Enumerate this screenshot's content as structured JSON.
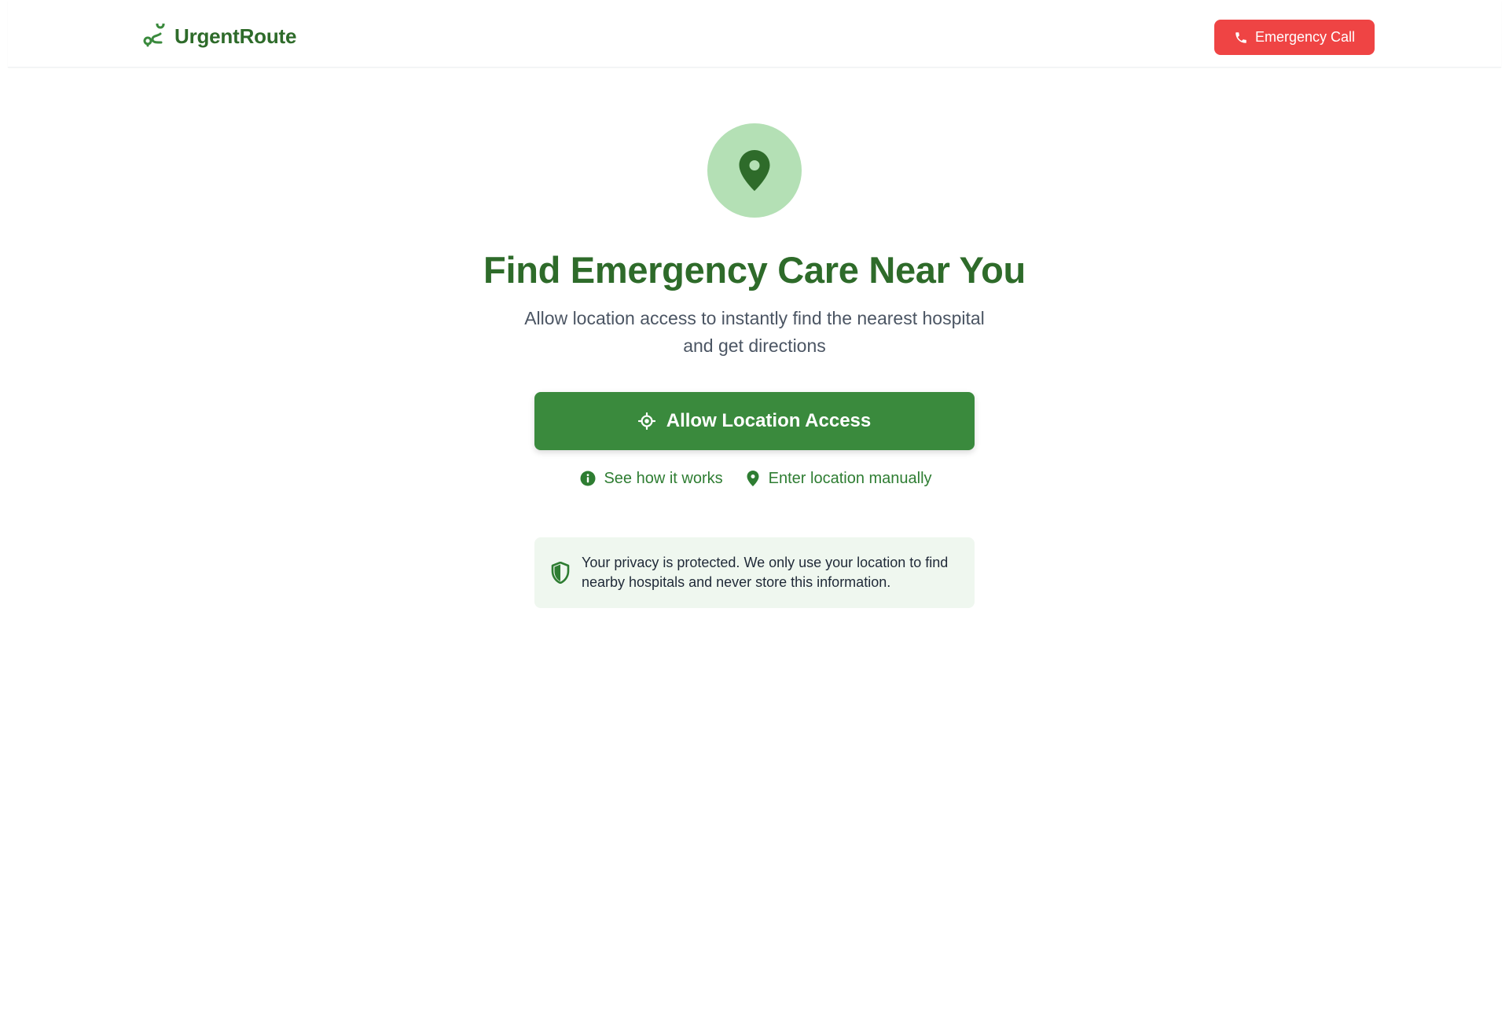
{
  "header": {
    "brand_name": "UrgentRoute",
    "emergency_button_label": "Emergency Call"
  },
  "hero": {
    "title": "Find Emergency Care Near You",
    "subtitle": "Allow location access to instantly find the nearest hospital and get directions",
    "allow_button_label": "Allow Location Access"
  },
  "links": {
    "how_it_works_label": "See how it works",
    "manual_location_label": "Enter location manually"
  },
  "privacy": {
    "text": "Your privacy is protected. We only use your location to find nearby hospitals and never store this information."
  },
  "icons": {
    "brand": "route-icon",
    "emergency": "phone-icon",
    "hero": "map-pin-icon",
    "allow": "crosshair-icon",
    "how_it_works": "info-icon",
    "manual_location": "map-pin-icon",
    "privacy": "shield-icon"
  },
  "colors": {
    "primary_green": "#3a8a3d",
    "dark_green": "#2e6b2a",
    "light_green_circle": "#b4e0b5",
    "privacy_bg": "#eff7ef",
    "emergency_red": "#ef4444",
    "body_text": "#4b5563"
  }
}
